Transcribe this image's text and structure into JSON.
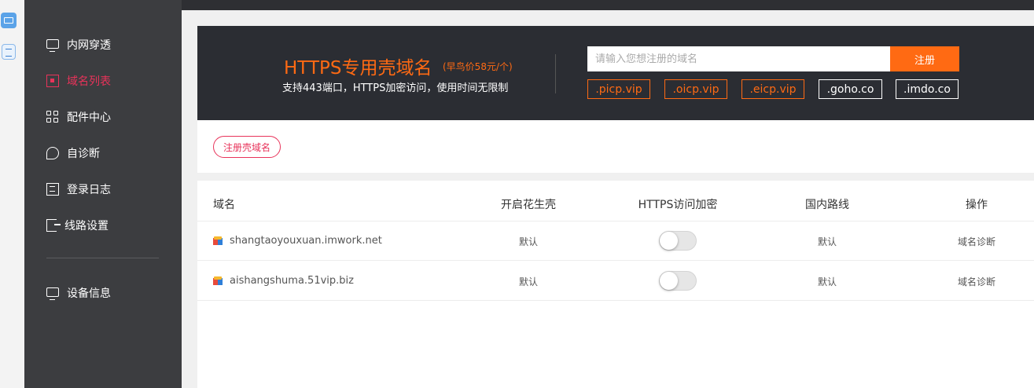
{
  "sidebar": {
    "items": [
      {
        "label": "内网穿透",
        "icon": "monitor-icon",
        "active": false
      },
      {
        "label": "域名列表",
        "icon": "list-icon",
        "active": true
      },
      {
        "label": "配件中心",
        "icon": "grid-icon",
        "active": false
      },
      {
        "label": "自诊断",
        "icon": "diagnose-icon",
        "active": false
      },
      {
        "label": "登录日志",
        "icon": "log-icon",
        "active": false
      },
      {
        "label": "线路设置",
        "icon": "exit-icon",
        "active": false
      }
    ],
    "bottom_item": {
      "label": "设备信息",
      "icon": "monitor-icon"
    }
  },
  "banner": {
    "title": "HTTPS专用壳域名",
    "price": "(早鸟价58元/个)",
    "subtitle": "支持443端口，HTTPS加密访问，使用时间无限制",
    "search_placeholder": "请输入您想注册的域名",
    "register_label": "注册",
    "suffixes": [
      ".picp.vip",
      ".oicp.vip",
      ".eicp.vip",
      ".goho.co",
      ".imdo.co"
    ]
  },
  "register_shell_label": "注册壳域名",
  "table": {
    "headers": [
      "域名",
      "开启花生壳",
      "HTTPS访问加密",
      "国内路线",
      "操作"
    ],
    "rows": [
      {
        "domain": "shangtaoyouxuan.imwork.net",
        "shell": "默认",
        "https_enabled": false,
        "route": "默认",
        "action": "域名诊断"
      },
      {
        "domain": "aishangshuma.51vip.biz",
        "shell": "默认",
        "https_enabled": false,
        "route": "默认",
        "action": "域名诊断"
      }
    ]
  },
  "colors": {
    "accent": "#ff6a13",
    "active": "#e8335a",
    "sidebar_bg": "#3c3d40",
    "banner_bg": "#2b2d33"
  }
}
